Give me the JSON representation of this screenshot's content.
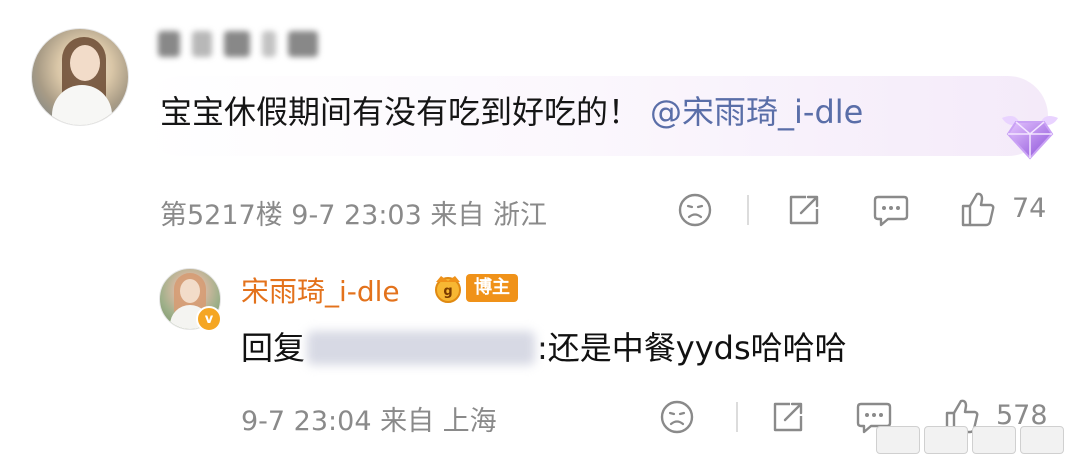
{
  "comment": {
    "text": "宝宝休假期间有没有吃到好吃的！",
    "mention": "@宋雨琦_i-dle",
    "floor_time_location": "第5217楼 9-7 23:03 来自 浙江",
    "like_count": "74",
    "badge_icon": "diamond-fan-badge-icon"
  },
  "reply": {
    "author_name": "宋雨琦_i-dle",
    "author_badge": "博主",
    "reply_prefix": "回复",
    "reply_body": ":还是中餐yyds哈哈哈",
    "time_location": "9-7 23:04 来自 上海",
    "like_count": "578"
  },
  "colors": {
    "mention": "#5a6ea8",
    "author_name": "#e3721c",
    "badge": "#f09219",
    "meta_text": "#8a8a8a"
  }
}
